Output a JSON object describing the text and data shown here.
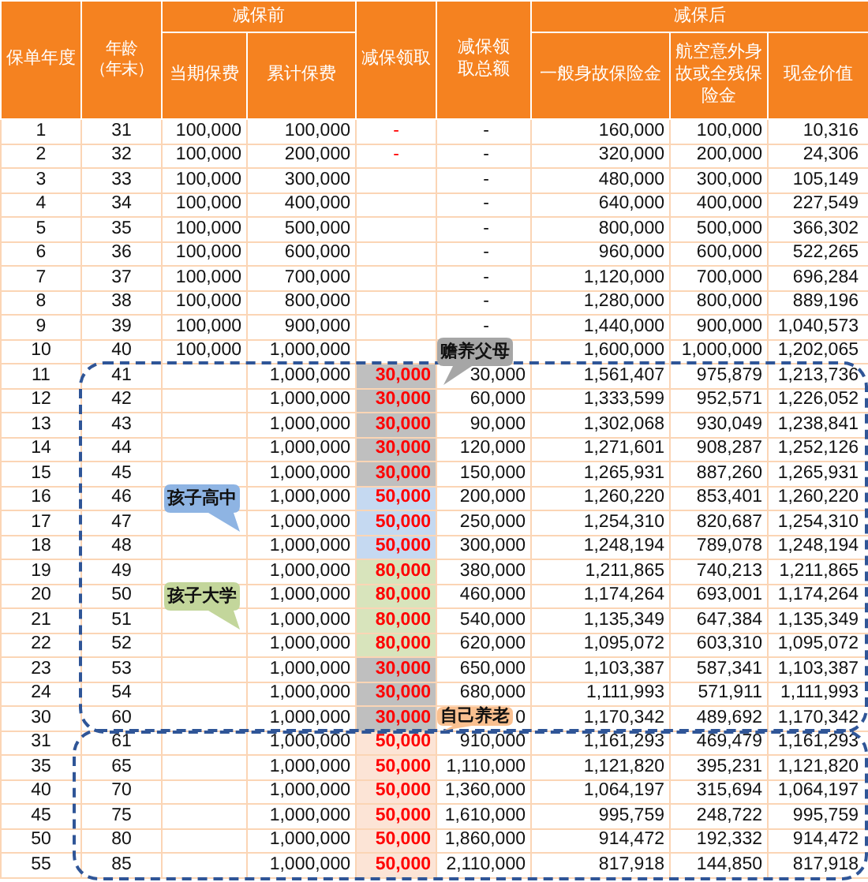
{
  "table": {
    "header_groups": [
      {
        "label": "保单年度"
      },
      {
        "label": "年龄（年末）"
      },
      {
        "label": "减保前"
      },
      {
        "label": "减保领取"
      },
      {
        "label": "减保领取总额"
      },
      {
        "label": "减保后"
      }
    ],
    "columns": [
      "当期保费",
      "累计保费",
      "一般身故保险金",
      "航空意外身故或全残保险金",
      "现金价值"
    ],
    "rows": [
      {
        "year": "1",
        "age": "31",
        "premium": "100,000",
        "cumulative": "100,000",
        "withdrawal": "-",
        "total": "-",
        "death_benefit": "160,000",
        "accident_benefit": "100,000",
        "cash_value": "10,316"
      },
      {
        "year": "2",
        "age": "32",
        "premium": "100,000",
        "cumulative": "200,000",
        "withdrawal": "-",
        "total": "-",
        "death_benefit": "320,000",
        "accident_benefit": "200,000",
        "cash_value": "24,306"
      },
      {
        "year": "3",
        "age": "33",
        "premium": "100,000",
        "cumulative": "300,000",
        "total": "-",
        "death_benefit": "480,000",
        "accident_benefit": "300,000",
        "cash_value": "105,149"
      },
      {
        "year": "4",
        "age": "34",
        "premium": "100,000",
        "cumulative": "400,000",
        "total": "-",
        "death_benefit": "640,000",
        "accident_benefit": "400,000",
        "cash_value": "227,549"
      },
      {
        "year": "5",
        "age": "35",
        "premium": "100,000",
        "cumulative": "500,000",
        "total": "-",
        "death_benefit": "800,000",
        "accident_benefit": "500,000",
        "cash_value": "366,302"
      },
      {
        "year": "6",
        "age": "36",
        "premium": "100,000",
        "cumulative": "600,000",
        "total": "-",
        "death_benefit": "960,000",
        "accident_benefit": "600,000",
        "cash_value": "522,265"
      },
      {
        "year": "7",
        "age": "37",
        "premium": "100,000",
        "cumulative": "700,000",
        "total": "-",
        "death_benefit": "1,120,000",
        "accident_benefit": "700,000",
        "cash_value": "696,284"
      },
      {
        "year": "8",
        "age": "38",
        "premium": "100,000",
        "cumulative": "800,000",
        "total": "-",
        "death_benefit": "1,280,000",
        "accident_benefit": "800,000",
        "cash_value": "889,196"
      },
      {
        "year": "9",
        "age": "39",
        "premium": "100,000",
        "cumulative": "900,000",
        "total": "-",
        "death_benefit": "1,440,000",
        "accident_benefit": "900,000",
        "cash_value": "1,040,573"
      },
      {
        "year": "10",
        "age": "40",
        "premium": "100,000",
        "cumulative": "1,000,000",
        "death_benefit": "1,600,000",
        "accident_benefit": "1,000,000",
        "cash_value": "1,202,065"
      },
      {
        "year": "11",
        "age": "41",
        "cumulative": "1,000,000",
        "withdrawal": "30,000",
        "color": "#bfbfbf",
        "total": "30,000",
        "death_benefit": "1,561,407",
        "accident_benefit": "975,879",
        "cash_value": "1,213,736"
      },
      {
        "year": "12",
        "age": "42",
        "cumulative": "1,000,000",
        "withdrawal": "30,000",
        "color": "#bfbfbf",
        "total": "60,000",
        "death_benefit": "1,333,599",
        "accident_benefit": "952,571",
        "cash_value": "1,226,052"
      },
      {
        "year": "13",
        "age": "43",
        "cumulative": "1,000,000",
        "withdrawal": "30,000",
        "color": "#bfbfbf",
        "total": "90,000",
        "death_benefit": "1,302,068",
        "accident_benefit": "930,049",
        "cash_value": "1,238,841"
      },
      {
        "year": "14",
        "age": "44",
        "cumulative": "1,000,000",
        "withdrawal": "30,000",
        "color": "#bfbfbf",
        "total": "120,000",
        "death_benefit": "1,271,601",
        "accident_benefit": "908,287",
        "cash_value": "1,252,126"
      },
      {
        "year": "15",
        "age": "45",
        "cumulative": "1,000,000",
        "withdrawal": "30,000",
        "color": "#bfbfbf",
        "total": "150,000",
        "death_benefit": "1,265,931",
        "accident_benefit": "887,260",
        "cash_value": "1,265,931"
      },
      {
        "year": "16",
        "age": "46",
        "cumulative": "1,000,000",
        "withdrawal": "50,000",
        "color": "#c5d9f1",
        "total": "200,000",
        "death_benefit": "1,260,220",
        "accident_benefit": "853,401",
        "cash_value": "1,260,220"
      },
      {
        "year": "17",
        "age": "47",
        "cumulative": "1,000,000",
        "withdrawal": "50,000",
        "color": "#c5d9f1",
        "total": "250,000",
        "death_benefit": "1,254,310",
        "accident_benefit": "820,687",
        "cash_value": "1,254,310"
      },
      {
        "year": "18",
        "age": "48",
        "cumulative": "1,000,000",
        "withdrawal": "50,000",
        "color": "#c5d9f1",
        "total": "300,000",
        "death_benefit": "1,248,194",
        "accident_benefit": "789,078",
        "cash_value": "1,248,194"
      },
      {
        "year": "19",
        "age": "49",
        "cumulative": "1,000,000",
        "withdrawal": "80,000",
        "color": "#d8e4bc",
        "total": "380,000",
        "death_benefit": "1,211,865",
        "accident_benefit": "740,213",
        "cash_value": "1,211,865"
      },
      {
        "year": "20",
        "age": "50",
        "cumulative": "1,000,000",
        "withdrawal": "80,000",
        "color": "#d8e4bc",
        "total": "460,000",
        "death_benefit": "1,174,264",
        "accident_benefit": "693,001",
        "cash_value": "1,174,264"
      },
      {
        "year": "21",
        "age": "51",
        "cumulative": "1,000,000",
        "withdrawal": "80,000",
        "color": "#d8e4bc",
        "total": "540,000",
        "death_benefit": "1,135,349",
        "accident_benefit": "647,384",
        "cash_value": "1,135,349"
      },
      {
        "year": "22",
        "age": "52",
        "cumulative": "1,000,000",
        "withdrawal": "80,000",
        "color": "#d8e4bc",
        "total": "620,000",
        "death_benefit": "1,095,072",
        "accident_benefit": "603,310",
        "cash_value": "1,095,072"
      },
      {
        "year": "23",
        "age": "53",
        "cumulative": "1,000,000",
        "withdrawal": "30,000",
        "color": "#bfbfbf",
        "total": "650,000",
        "death_benefit": "1,103,387",
        "accident_benefit": "587,341",
        "cash_value": "1,103,387"
      },
      {
        "year": "24",
        "age": "54",
        "cumulative": "1,000,000",
        "withdrawal": "30,000",
        "color": "#bfbfbf",
        "total": "680,000",
        "death_benefit": "1,111,993",
        "accident_benefit": "571,911",
        "cash_value": "1,111,993"
      },
      {
        "year": "30",
        "age": "60",
        "cumulative": "1,000,000",
        "withdrawal": "30,000",
        "color": "#bfbfbf",
        "total": "0",
        "death_benefit": "1,170,342",
        "accident_benefit": "489,692",
        "cash_value": "1,170,342"
      },
      {
        "year": "31",
        "age": "61",
        "cumulative": "1,000,000",
        "withdrawal": "50,000",
        "color": "#fce4d6",
        "total": "910,000",
        "death_benefit": "1,161,293",
        "accident_benefit": "469,479",
        "cash_value": "1,161,293"
      },
      {
        "year": "35",
        "age": "65",
        "cumulative": "1,000,000",
        "withdrawal": "50,000",
        "color": "#fce4d6",
        "total": "1,110,000",
        "death_benefit": "1,121,820",
        "accident_benefit": "395,231",
        "cash_value": "1,121,820"
      },
      {
        "year": "40",
        "age": "70",
        "cumulative": "1,000,000",
        "withdrawal": "50,000",
        "color": "#fce4d6",
        "total": "1,360,000",
        "death_benefit": "1,064,197",
        "accident_benefit": "315,694",
        "cash_value": "1,064,197"
      },
      {
        "year": "45",
        "age": "75",
        "cumulative": "1,000,000",
        "withdrawal": "50,000",
        "color": "#fce4d6",
        "total": "1,610,000",
        "death_benefit": "995,759",
        "accident_benefit": "248,722",
        "cash_value": "995,759"
      },
      {
        "year": "50",
        "age": "80",
        "cumulative": "1,000,000",
        "withdrawal": "50,000",
        "color": "#fce4d6",
        "total": "1,860,000",
        "death_benefit": "914,472",
        "accident_benefit": "192,332",
        "cash_value": "914,472"
      },
      {
        "year": "55",
        "age": "85",
        "cumulative": "1,000,000",
        "withdrawal": "50,000",
        "color": "#fce4d6",
        "total": "2,110,000",
        "death_benefit": "817,918",
        "accident_benefit": "144,850",
        "cash_value": "817,918"
      }
    ]
  },
  "callouts": [
    {
      "text": "赡养父母",
      "color": "#a6a6a6"
    },
    {
      "text": "孩子高中",
      "color": "#8eb4e3"
    },
    {
      "text": "孩子大学",
      "color": "#c3d69b"
    },
    {
      "text": "自己养老",
      "color": "#fac090"
    }
  ]
}
